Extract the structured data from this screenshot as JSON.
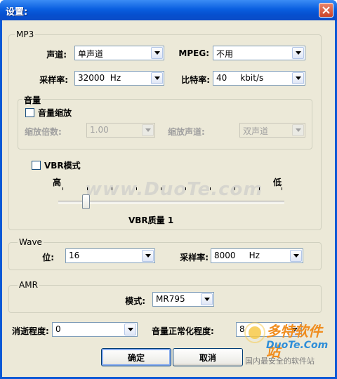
{
  "window": {
    "title": "设置:"
  },
  "mp3": {
    "group_label": "MP3",
    "channel_label": "声道:",
    "channel_value": "单声道",
    "mpeg_label": "MPEG:",
    "mpeg_value": "不用",
    "samplerate_label": "采样率:",
    "samplerate_value": "32000  Hz",
    "bitrate_label": "比特率:",
    "bitrate_value": "40     kbit/s",
    "volume": {
      "group_label": "音量",
      "scale_check_label": "音量缩放",
      "scale_factor_label": "缩放倍数:",
      "scale_factor_value": "1.00",
      "scale_channel_label": "缩放声道:",
      "scale_channel_value": "双声道"
    },
    "vbr": {
      "check_label": "VBR模式",
      "high_label": "高",
      "low_label": "低",
      "quality_label": "VBR质量 1",
      "quality_level": 1
    }
  },
  "wave": {
    "group_label": "Wave",
    "bits_label": "位:",
    "bits_value": "16",
    "samplerate_label": "采样率:",
    "samplerate_value": "8000     Hz"
  },
  "amr": {
    "group_label": "AMR",
    "mode_label": "模式:",
    "mode_value": "MR795"
  },
  "bottom": {
    "fade_label": "消逝程度:",
    "fade_value": "0",
    "normalize_label": "音量正常化程度:",
    "normalize_value": "8"
  },
  "buttons": {
    "ok": "确定",
    "cancel": "取消"
  },
  "watermark": {
    "text": "www.DuoTe.com"
  },
  "logo": {
    "line1": "多特软件站",
    "line2": "DuoTe.Com",
    "line3": "国内最安全的软件站"
  },
  "colors": {
    "titlebar": "#0a5fe0",
    "client": "#ece9d8",
    "close": "#c8442a"
  }
}
